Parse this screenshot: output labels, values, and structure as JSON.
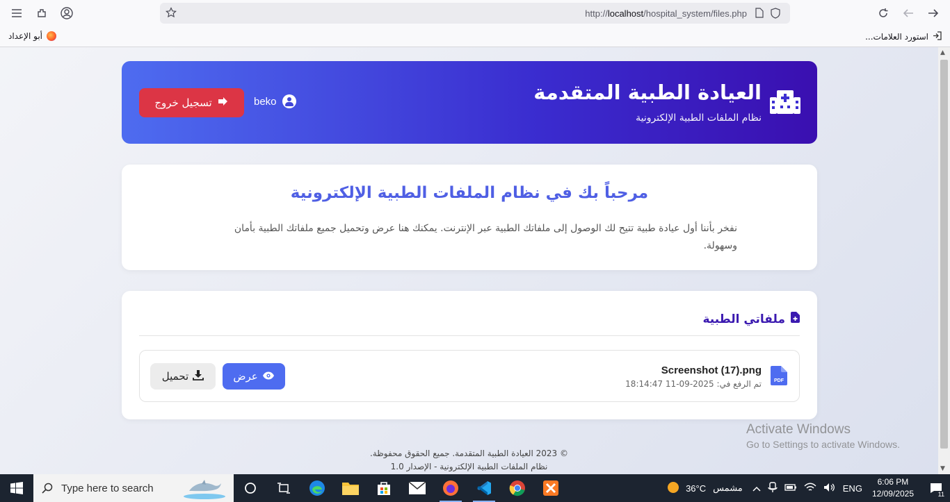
{
  "browser": {
    "url_prefix": "http://",
    "url_host": "localhost",
    "url_path": "/hospital_system/files.php",
    "bookmark_left": "أبو الإعداد",
    "bookmark_right": "استورد العلامات..."
  },
  "header": {
    "title": "العيادة الطبية المتقدمة",
    "subtitle": "نظام الملفات الطبية الإلكترونية",
    "username": "beko",
    "logout_label": "تسجيل خروج"
  },
  "welcome": {
    "title": "مرحباً بك في نظام الملفات الطبية الإلكترونية",
    "text": "نفخر بأننا أول عيادة طبية تتيح لك الوصول إلى ملفاتك الطبية عبر الإنترنت. يمكنك هنا عرض وتحميل جميع ملفاتك الطبية بأمان وسهولة."
  },
  "files": {
    "heading": "ملفاتي الطبية",
    "items": [
      {
        "name": "Screenshot (17).png",
        "date": "تم الرفع في: 2025-09-11 18:14:47",
        "view_label": "عرض",
        "download_label": "تحميل"
      }
    ]
  },
  "footer": {
    "line1": "© 2023 العيادة الطبية المتقدمة. جميع الحقوق محفوظة.",
    "line2": "نظام الملفات الطبية الإلكترونية - الإصدار 1.0"
  },
  "watermark": {
    "line1": "Activate Windows",
    "line2": "Go to Settings to activate Windows."
  },
  "taskbar": {
    "search_placeholder": "Type here to search",
    "weather_temp": "36°C",
    "weather_text": "مشمس",
    "language": "ENG",
    "time": "6:06 PM",
    "date": "12/09/2025",
    "notification_count": "11"
  },
  "colors": {
    "primary": "#4e6cf0",
    "header_gradient_end": "#3a0fb0",
    "logout": "#dc3545",
    "heading": "#3b1ab0"
  }
}
